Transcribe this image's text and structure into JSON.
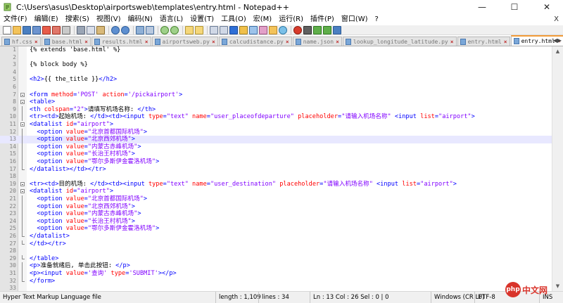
{
  "window": {
    "title": "C:\\Users\\asus\\Desktop\\airportsweb\\templates\\entry.html - Notepad++",
    "minimize": "—",
    "maximize": "☐",
    "close": "✕"
  },
  "menu": {
    "items": [
      "文件(F)",
      "编辑(E)",
      "搜索(S)",
      "视图(V)",
      "编码(N)",
      "语言(L)",
      "设置(T)",
      "工具(O)",
      "宏(M)",
      "运行(R)",
      "插件(P)",
      "窗口(W)",
      "?"
    ],
    "close_glyph": "X"
  },
  "tabs": [
    {
      "label": "hf.css",
      "active": false
    },
    {
      "label": "base.html",
      "active": false
    },
    {
      "label": "results.html",
      "active": false
    },
    {
      "label": "airportsweb.py",
      "active": false
    },
    {
      "label": "calcudistance.py",
      "active": false
    },
    {
      "label": "name.json",
      "active": false
    },
    {
      "label": "lookup_longitude_latitude.py",
      "active": false
    },
    {
      "label": "entry.html",
      "active": false
    },
    {
      "label": "entry.html",
      "active": true
    }
  ],
  "tab_close_glyph": "×",
  "code_lines": [
    {
      "n": "1",
      "fold": "",
      "current": false,
      "tokens": [
        [
          "{% extends 'base.html' %}",
          "plain"
        ]
      ]
    },
    {
      "n": "2",
      "fold": "",
      "current": false,
      "tokens": []
    },
    {
      "n": "3",
      "fold": "",
      "current": false,
      "tokens": [
        [
          "{% block body %}",
          "plain"
        ]
      ]
    },
    {
      "n": "4",
      "fold": "",
      "current": false,
      "tokens": []
    },
    {
      "n": "5",
      "fold": "",
      "current": false,
      "tokens": [
        [
          "<h2>",
          "tag"
        ],
        [
          "{{ the_title }}",
          "plain"
        ],
        [
          "</h2>",
          "tag"
        ]
      ]
    },
    {
      "n": "6",
      "fold": "",
      "current": false,
      "tokens": []
    },
    {
      "n": "7",
      "fold": "box",
      "current": false,
      "tokens": [
        [
          "<form ",
          "tag"
        ],
        [
          "method",
          "attr"
        ],
        [
          "=",
          "tag"
        ],
        [
          "'POST'",
          "val"
        ],
        [
          " action",
          "attr"
        ],
        [
          "=",
          "tag"
        ],
        [
          "'/pickairport'",
          "val"
        ],
        [
          ">",
          "tag"
        ]
      ]
    },
    {
      "n": "8",
      "fold": "box",
      "current": false,
      "tokens": [
        [
          "<table>",
          "tag"
        ]
      ]
    },
    {
      "n": "9",
      "fold": "bar",
      "current": false,
      "tokens": [
        [
          "<th ",
          "tag"
        ],
        [
          "colspan",
          "attr"
        ],
        [
          "=",
          "tag"
        ],
        [
          "\"2\"",
          "val"
        ],
        [
          ">",
          "tag"
        ],
        [
          "请填写机场名称: ",
          "text"
        ],
        [
          "</th>",
          "tag"
        ]
      ]
    },
    {
      "n": "10",
      "fold": "bar",
      "current": false,
      "tokens": [
        [
          "<tr><td>",
          "tag"
        ],
        [
          "起始机场: ",
          "text"
        ],
        [
          "</td><td><input ",
          "tag"
        ],
        [
          "type",
          "attr"
        ],
        [
          "=",
          "tag"
        ],
        [
          "\"text\"",
          "val"
        ],
        [
          " name",
          "attr"
        ],
        [
          "=",
          "tag"
        ],
        [
          "\"user_placeofdeparture\"",
          "val"
        ],
        [
          " placeholder",
          "attr"
        ],
        [
          "=",
          "tag"
        ],
        [
          "\"请输入机场名称\"",
          "val"
        ],
        [
          " <input ",
          "tag"
        ],
        [
          "list",
          "attr"
        ],
        [
          "=",
          "tag"
        ],
        [
          "\"airport\"",
          "val"
        ],
        [
          ">",
          "tag"
        ]
      ]
    },
    {
      "n": "11",
      "fold": "box",
      "current": false,
      "tokens": [
        [
          "<datalist ",
          "tag"
        ],
        [
          "id",
          "attr"
        ],
        [
          "=",
          "tag"
        ],
        [
          "\"airport\"",
          "val"
        ],
        [
          ">",
          "tag"
        ]
      ]
    },
    {
      "n": "12",
      "fold": "bar",
      "current": false,
      "tokens": [
        [
          "  <option ",
          "tag"
        ],
        [
          "value",
          "attr"
        ],
        [
          "=",
          "tag"
        ],
        [
          "\"北京首都国际机场\"",
          "val"
        ],
        [
          ">",
          "tag"
        ]
      ]
    },
    {
      "n": "13",
      "fold": "bar",
      "current": true,
      "tokens": [
        [
          "  <option ",
          "tag"
        ],
        [
          "value",
          "attr"
        ],
        [
          "=",
          "tag"
        ],
        [
          "\"北京西郊机场\"",
          "val"
        ],
        [
          ">",
          "tag"
        ]
      ]
    },
    {
      "n": "14",
      "fold": "bar",
      "current": false,
      "tokens": [
        [
          "  <option ",
          "tag"
        ],
        [
          "value",
          "attr"
        ],
        [
          "=",
          "tag"
        ],
        [
          "\"内蒙古赤峰机场\"",
          "val"
        ],
        [
          ">",
          "tag"
        ]
      ]
    },
    {
      "n": "15",
      "fold": "bar",
      "current": false,
      "tokens": [
        [
          "  <option ",
          "tag"
        ],
        [
          "value",
          "attr"
        ],
        [
          "=",
          "tag"
        ],
        [
          "\"长治王村机场\"",
          "val"
        ],
        [
          ">",
          "tag"
        ]
      ]
    },
    {
      "n": "16",
      "fold": "bar",
      "current": false,
      "tokens": [
        [
          "  <option ",
          "tag"
        ],
        [
          "value",
          "attr"
        ],
        [
          "=",
          "tag"
        ],
        [
          "\"鄂尔多斯伊金霍洛机场\"",
          "val"
        ],
        [
          ">",
          "tag"
        ]
      ]
    },
    {
      "n": "17",
      "fold": "end",
      "current": false,
      "tokens": [
        [
          "</datalist></td></tr>",
          "tag"
        ]
      ]
    },
    {
      "n": "18",
      "fold": "",
      "current": false,
      "tokens": []
    },
    {
      "n": "19",
      "fold": "box",
      "current": false,
      "tokens": [
        [
          "<tr><td>",
          "tag"
        ],
        [
          "目的机场: ",
          "text"
        ],
        [
          "</td><td><input ",
          "tag"
        ],
        [
          "type",
          "attr"
        ],
        [
          "=",
          "tag"
        ],
        [
          "\"text\"",
          "val"
        ],
        [
          " name",
          "attr"
        ],
        [
          "=",
          "tag"
        ],
        [
          "\"user_destination\"",
          "val"
        ],
        [
          " placeholder",
          "attr"
        ],
        [
          "=",
          "tag"
        ],
        [
          "\"请输入机场名称\"",
          "val"
        ],
        [
          " <input ",
          "tag"
        ],
        [
          "list",
          "attr"
        ],
        [
          "=",
          "tag"
        ],
        [
          "\"airport\"",
          "val"
        ],
        [
          ">",
          "tag"
        ]
      ]
    },
    {
      "n": "20",
      "fold": "box",
      "current": false,
      "tokens": [
        [
          "<datalist ",
          "tag"
        ],
        [
          "id",
          "attr"
        ],
        [
          "=",
          "tag"
        ],
        [
          "\"airport\"",
          "val"
        ],
        [
          ">",
          "tag"
        ]
      ]
    },
    {
      "n": "21",
      "fold": "bar",
      "current": false,
      "tokens": [
        [
          "  <option ",
          "tag"
        ],
        [
          "value",
          "attr"
        ],
        [
          "=",
          "tag"
        ],
        [
          "\"北京首都国际机场\"",
          "val"
        ],
        [
          ">",
          "tag"
        ]
      ]
    },
    {
      "n": "22",
      "fold": "bar",
      "current": false,
      "tokens": [
        [
          "  <option ",
          "tag"
        ],
        [
          "value",
          "attr"
        ],
        [
          "=",
          "tag"
        ],
        [
          "\"北京西郊机场\"",
          "val"
        ],
        [
          ">",
          "tag"
        ]
      ]
    },
    {
      "n": "23",
      "fold": "bar",
      "current": false,
      "tokens": [
        [
          "  <option ",
          "tag"
        ],
        [
          "value",
          "attr"
        ],
        [
          "=",
          "tag"
        ],
        [
          "\"内蒙古赤峰机场\"",
          "val"
        ],
        [
          ">",
          "tag"
        ]
      ]
    },
    {
      "n": "24",
      "fold": "bar",
      "current": false,
      "tokens": [
        [
          "  <option ",
          "tag"
        ],
        [
          "value",
          "attr"
        ],
        [
          "=",
          "tag"
        ],
        [
          "\"长治王村机场\"",
          "val"
        ],
        [
          ">",
          "tag"
        ]
      ]
    },
    {
      "n": "25",
      "fold": "bar",
      "current": false,
      "tokens": [
        [
          "  <option ",
          "tag"
        ],
        [
          "value",
          "attr"
        ],
        [
          "=",
          "tag"
        ],
        [
          "\"鄂尔多斯伊金霍洛机场\"",
          "val"
        ],
        [
          ">",
          "tag"
        ]
      ]
    },
    {
      "n": "26",
      "fold": "end",
      "current": false,
      "tokens": [
        [
          "</datalist>",
          "tag"
        ]
      ]
    },
    {
      "n": "27",
      "fold": "end",
      "current": false,
      "tokens": [
        [
          "</td></tr>",
          "tag"
        ]
      ]
    },
    {
      "n": "28",
      "fold": "",
      "current": false,
      "tokens": []
    },
    {
      "n": "29",
      "fold": "end",
      "current": false,
      "tokens": [
        [
          "</table>",
          "tag"
        ]
      ]
    },
    {
      "n": "30",
      "fold": "bar",
      "current": false,
      "tokens": [
        [
          "<p>",
          "tag"
        ],
        [
          "准备就绪后, 单击此按钮: ",
          "text"
        ],
        [
          "</p>",
          "tag"
        ]
      ]
    },
    {
      "n": "31",
      "fold": "bar",
      "current": false,
      "tokens": [
        [
          "<p><input ",
          "tag"
        ],
        [
          "value",
          "attr"
        ],
        [
          "=",
          "tag"
        ],
        [
          "'查询'",
          "val"
        ],
        [
          " type",
          "attr"
        ],
        [
          "=",
          "tag"
        ],
        [
          "'SUBMIT'",
          "val"
        ],
        [
          "></p>",
          "tag"
        ]
      ]
    },
    {
      "n": "32",
      "fold": "end",
      "current": false,
      "tokens": [
        [
          "</form>",
          "tag"
        ]
      ]
    },
    {
      "n": "33",
      "fold": "",
      "current": false,
      "tokens": []
    }
  ],
  "status": {
    "language": "Hyper Text Markup Language file",
    "length": "length : 1,109",
    "lines": "lines : 34",
    "position": "Ln : 13    Col : 26    Sel : 0 | 0",
    "eol": "Windows (CR LF)",
    "encoding": "UTF-8",
    "mode": "INS"
  },
  "watermark": {
    "circle": "php",
    "text": "中文网"
  },
  "colors": {
    "tag": "#0000ff",
    "attr": "#ff0000",
    "val": "#8000ff",
    "text": "#000000",
    "plain": "#000000",
    "tab_accent": "#f29b38"
  }
}
